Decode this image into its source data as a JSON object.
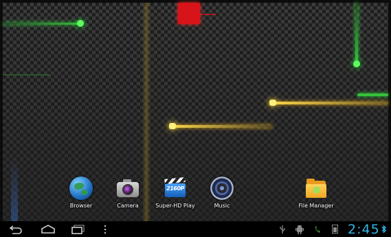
{
  "apps": [
    {
      "id": "browser",
      "label": "Browser",
      "icon": "globe-icon"
    },
    {
      "id": "camera",
      "label": "Camera",
      "icon": "camera-icon"
    },
    {
      "id": "superhd",
      "label": "Super-HD Play",
      "icon": "video-player-icon",
      "badge": "2160P"
    },
    {
      "id": "music",
      "label": "Music",
      "icon": "speaker-icon"
    },
    {
      "id": "filemanager",
      "label": "File Manager",
      "icon": "folder-icon"
    }
  ],
  "navigation": {
    "back": "back-icon",
    "home": "home-icon",
    "recent": "recent-apps-icon",
    "menu": "menu-icon"
  },
  "status_bar": {
    "time": "2:45",
    "icons": [
      "usb-icon",
      "android-debug-icon",
      "phone-icon",
      "storage-icon",
      "bluetooth-icon"
    ],
    "accent_color": "#33b5e5"
  },
  "colors": {
    "glow_green": "#36c23a",
    "glow_yellow": "#ffd84a",
    "glow_red": "#d7141a"
  }
}
